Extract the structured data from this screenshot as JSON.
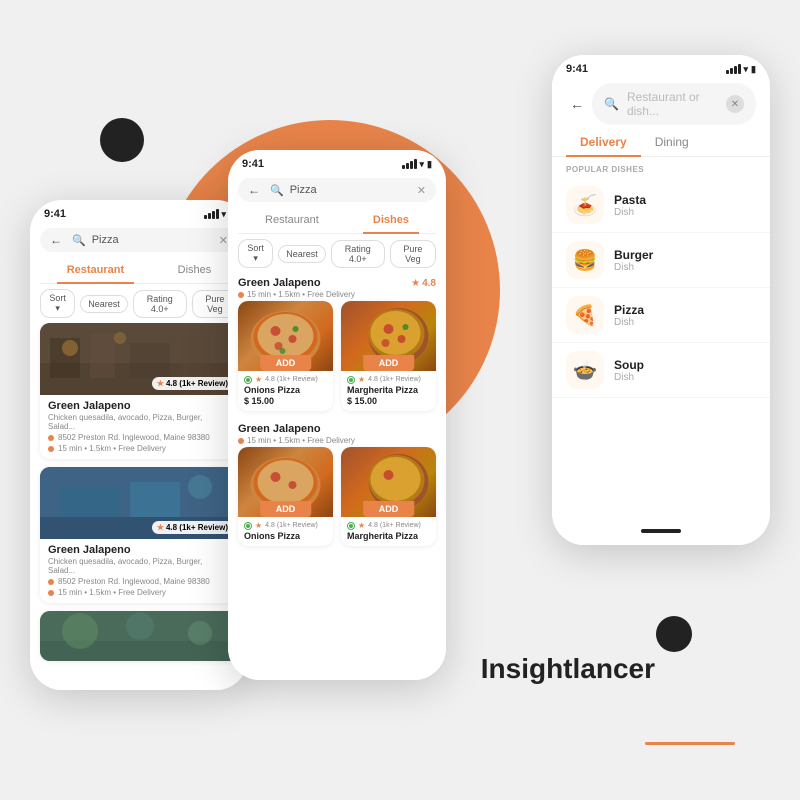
{
  "background": {
    "accent_color": "#E8844A"
  },
  "brand": {
    "name": "Insightlancer"
  },
  "phone_left": {
    "status": {
      "time": "9:41"
    },
    "search": {
      "placeholder": "Pizza",
      "back": "←",
      "clear": "✕"
    },
    "tabs": [
      {
        "label": "Restaurant",
        "active": true
      },
      {
        "label": "Dishes",
        "active": false
      }
    ],
    "filters": [
      "Sort ▾",
      "Nearest",
      "Rating 4.0+",
      "Pure Veg"
    ],
    "restaurants": [
      {
        "name": "Green Jalapeno",
        "subtitle": "Chicken quesadila, avocado, Pizza, Burger, Salad...",
        "address": "8502 Preston Rd. Inglewood, Maine 98380",
        "delivery": "15 min • 1.5km • Free Delivery",
        "rating": "4.8 (1k+ Review)"
      },
      {
        "name": "Green Jalapeno",
        "subtitle": "Chicken quesadila, avocado, Pizza, Burger, Salad...",
        "address": "8502 Preston Rd. Inglewood, Maine 98380",
        "delivery": "15 min • 1.5km • Free Delivery",
        "rating": "4.8 (1k+ Review)"
      }
    ]
  },
  "phone_center": {
    "status": {
      "time": "9:41"
    },
    "search": {
      "placeholder": "Pizza",
      "back": "←",
      "clear": "✕"
    },
    "tabs": [
      {
        "label": "Restaurant",
        "active": false
      },
      {
        "label": "Dishes",
        "active": true
      }
    ],
    "filters": [
      "Sort ▾",
      "Nearest",
      "Rating 4.0+",
      "Pure Veg"
    ],
    "sections": [
      {
        "name": "Green Jalapeno",
        "meta": "15 min • 1.5km • Free Delivery",
        "rating": "4.8",
        "dishes": [
          {
            "name": "Onions Pizza",
            "rating": "4.8 (1k+ Review)",
            "price": "$ 15.00",
            "add_label": "ADD"
          },
          {
            "name": "Margherita Pizza",
            "rating": "4.8 (1k+ Review)",
            "price": "$ 15.00",
            "add_label": "ADD"
          }
        ]
      },
      {
        "name": "Green Jalapeno",
        "meta": "15 min • 1.5km • Free Delivery",
        "dishes": [
          {
            "name": "Onions Pizza",
            "rating": "4.8 (1k+ Review)",
            "price": "",
            "add_label": "ADD"
          },
          {
            "name": "Margherita Pizza",
            "rating": "4.8 (1k+ Review)",
            "price": "",
            "add_label": "ADD"
          }
        ]
      }
    ]
  },
  "phone_right": {
    "status": {
      "time": "9:41"
    },
    "search": {
      "placeholder": "Restaurant or dish...",
      "back": "←",
      "clear": "✕"
    },
    "tabs": [
      {
        "label": "Delivery",
        "active": true
      },
      {
        "label": "Dining",
        "active": false
      }
    ],
    "popular_label": "POPULAR DISHES",
    "popular_items": [
      {
        "name": "Pasta",
        "type": "Dish",
        "icon": "🍝"
      },
      {
        "name": "Burger",
        "type": "Dish",
        "icon": "🍔"
      },
      {
        "name": "Pizza",
        "type": "Dish",
        "icon": "🍕"
      },
      {
        "name": "Soup",
        "type": "Dish",
        "icon": "🍲"
      }
    ]
  }
}
